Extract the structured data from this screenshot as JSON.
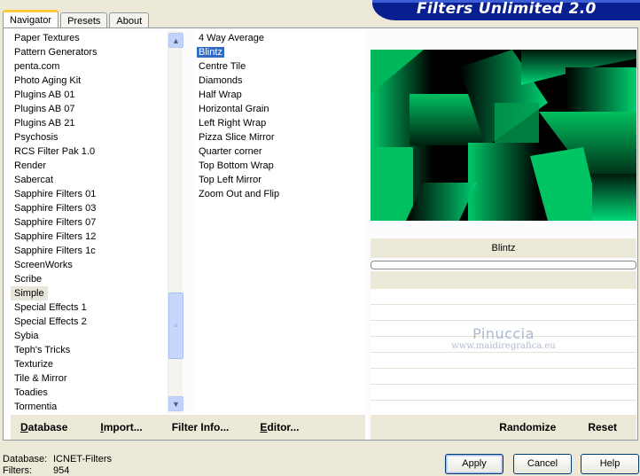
{
  "app": {
    "title": "Filters Unlimited 2.0"
  },
  "tabs": [
    {
      "label": "Navigator",
      "active": true
    },
    {
      "label": "Presets",
      "active": false
    },
    {
      "label": "About",
      "active": false
    }
  ],
  "categories": {
    "items": [
      "Paper Textures",
      "Pattern Generators",
      "penta.com",
      "Photo Aging Kit",
      "Plugins AB 01",
      "Plugins AB 07",
      "Plugins AB 21",
      "Psychosis",
      "RCS Filter Pak 1.0",
      "Render",
      "Sabercat",
      "Sapphire Filters 01",
      "Sapphire Filters 03",
      "Sapphire Filters 07",
      "Sapphire Filters 12",
      "Sapphire Filters 1c",
      "ScreenWorks",
      "Scribe",
      "Simple",
      "Special Effects 1",
      "Special Effects 2",
      "Sybia",
      "Teph's Tricks",
      "Texturize",
      "Tile & Mirror",
      "Toadies",
      "Tormentia"
    ],
    "selected": "Simple"
  },
  "filters": {
    "items": [
      "4 Way Average",
      "Blintz",
      "Centre Tile",
      "Diamonds",
      "Half Wrap",
      "Horizontal Grain",
      "Left Right Wrap",
      "Pizza Slice Mirror",
      "Quarter corner",
      "Top Bottom Wrap",
      "Top Left Mirror",
      "Zoom Out and Flip"
    ],
    "selected": "Blintz"
  },
  "preview": {
    "filter_name": "Blintz",
    "progress": 0,
    "accent_color": "#00c060"
  },
  "watermark": {
    "title": "Pinuccia",
    "url": "www.maidiregrafica.eu"
  },
  "left_buttons": [
    {
      "label": "Database",
      "underline": "D",
      "rest": "atabase",
      "name": "database-button"
    },
    {
      "label": "Import...",
      "underline": "I",
      "rest": "mport...",
      "name": "import-button"
    },
    {
      "label": "Filter Info...",
      "underline": "",
      "rest": "Filter Info...",
      "name": "filter-info-button"
    },
    {
      "label": "Editor...",
      "underline": "E",
      "rest": "ditor...",
      "name": "editor-button"
    }
  ],
  "right_buttons": {
    "randomize": "Randomize",
    "reset": "Reset"
  },
  "status": {
    "database_label": "Database:",
    "database_value": "ICNET-Filters",
    "filters_label": "Filters:",
    "filters_value": "954"
  },
  "dialog_buttons": {
    "apply": "Apply",
    "cancel": "Cancel",
    "help": "Help"
  },
  "scroll_icons": {
    "up": "chevron-up-icon",
    "down": "chevron-down-icon",
    "grip": "grip-icon"
  }
}
